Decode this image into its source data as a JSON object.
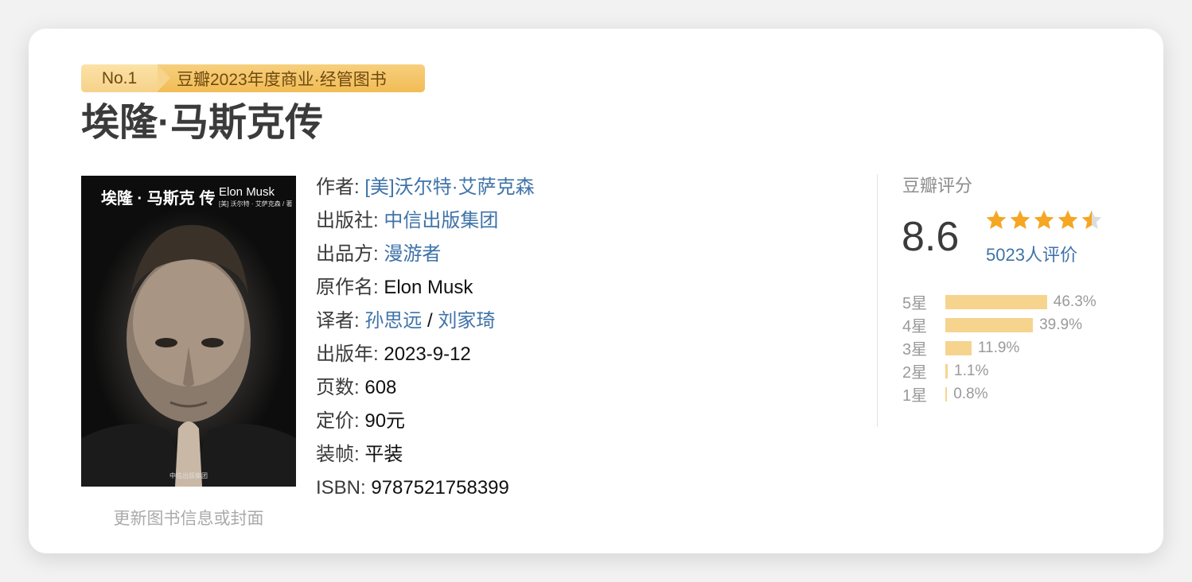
{
  "badge": {
    "rank": "No.1",
    "text": "豆瓣2023年度商业·经管图书"
  },
  "title": "埃隆·马斯克传",
  "cover": {
    "title_cn": "埃隆 · 马斯克 传",
    "title_en": "Elon Musk",
    "author": "[美] 沃尔特 · 艾萨克森 / 著",
    "publisher": "中信出版集团"
  },
  "update_link": "更新图书信息或封面",
  "info": {
    "author_label": "作者:",
    "author": "[美]沃尔特·艾萨克森",
    "publisher_label": "出版社:",
    "publisher": "中信出版集团",
    "producer_label": "出品方:",
    "producer": "漫游者",
    "original_label": "原作名:",
    "original": "Elon Musk",
    "translator_label": "译者:",
    "translator1": "孙思远",
    "translator_sep": " / ",
    "translator2": "刘家琦",
    "year_label": "出版年:",
    "year": "2023-9-12",
    "pages_label": "页数:",
    "pages": "608",
    "price_label": "定价:",
    "price": "90元",
    "binding_label": "装帧:",
    "binding": "平装",
    "isbn_label": "ISBN:",
    "isbn": "9787521758399"
  },
  "rating": {
    "label": "豆瓣评分",
    "score": "8.6",
    "stars": 4.5,
    "count": "5023人评价",
    "star_color": "#f5a623",
    "bar_color": "#f6d48e",
    "distribution": [
      {
        "label": "5星",
        "pct_text": "46.3%",
        "pct": 46.3
      },
      {
        "label": "4星",
        "pct_text": "39.9%",
        "pct": 39.9
      },
      {
        "label": "3星",
        "pct_text": "11.9%",
        "pct": 11.9
      },
      {
        "label": "2星",
        "pct_text": "1.1%",
        "pct": 1.1
      },
      {
        "label": "1星",
        "pct_text": "0.8%",
        "pct": 0.8
      }
    ]
  }
}
